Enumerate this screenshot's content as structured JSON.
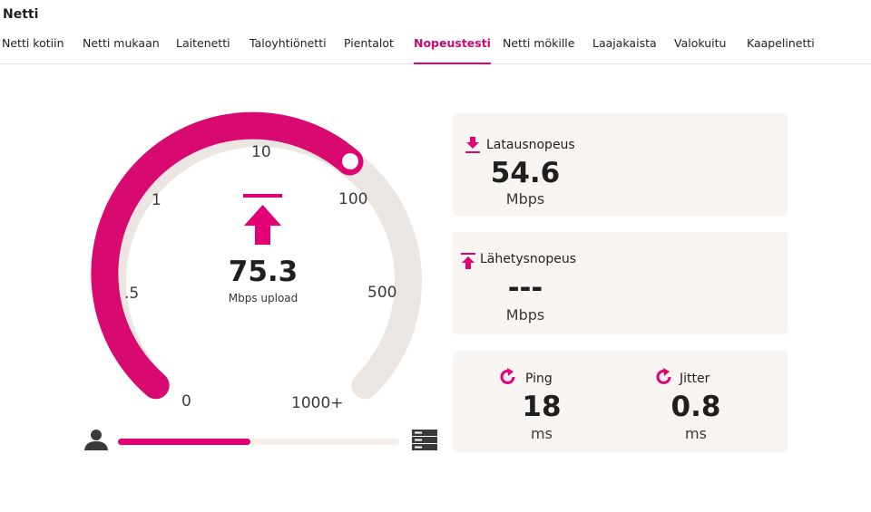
{
  "header": {
    "title": "Netti",
    "tabs": [
      {
        "label": "Netti kotiin"
      },
      {
        "label": "Netti mukaan"
      },
      {
        "label": "Laitenetti"
      },
      {
        "label": "Taloyhtiönetti"
      },
      {
        "label": "Pientalot"
      },
      {
        "label": "Nopeustesti",
        "active": true
      },
      {
        "label": "Netti mökille"
      },
      {
        "label": "Laajakaista"
      },
      {
        "label": "Valokuitu"
      },
      {
        "label": "Kaapelinetti"
      }
    ]
  },
  "gauge": {
    "ticks": [
      "0",
      ".5",
      "1",
      "10",
      "100",
      "500",
      "1000+"
    ],
    "value": "75.3",
    "unit_label": "Mbps upload",
    "icon": "upload-arrow-icon"
  },
  "progress": {
    "fraction": 0.47,
    "left_icon": "user-icon",
    "right_icon": "server-icon"
  },
  "download": {
    "title": "Latausnopeus",
    "value": "54.6",
    "unit": "Mbps",
    "icon": "download-arrow-icon"
  },
  "upload": {
    "title": "Lähetysnopeus",
    "value": "---",
    "unit": "Mbps",
    "icon": "upload-arrow-icon"
  },
  "ping": {
    "title": "Ping",
    "value": "18",
    "unit": "ms",
    "icon": "refresh-icon"
  },
  "jitter": {
    "title": "Jitter",
    "value": "0.8",
    "unit": "ms",
    "icon": "refresh-icon"
  },
  "colors": {
    "accent": "#e20074",
    "accent_dark": "#cc0a6f",
    "track": "#ebe6e1",
    "card_bg": "#f7f4f1"
  }
}
